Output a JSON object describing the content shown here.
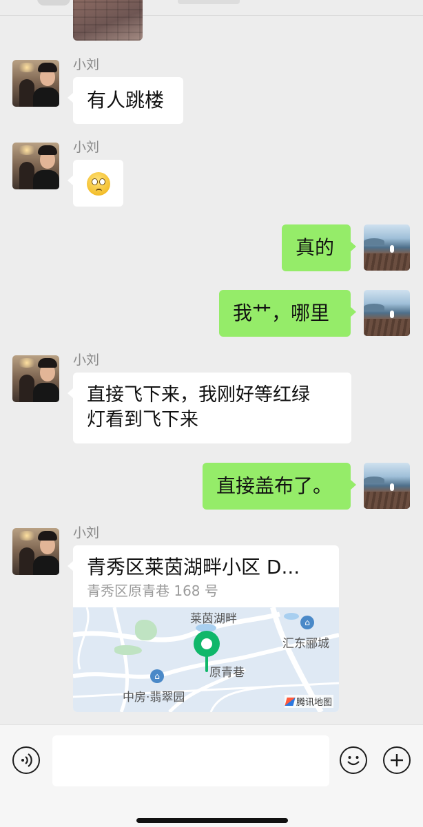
{
  "messages": [
    {
      "sender": "小刘",
      "text": "有人跳楼"
    },
    {
      "sender": "小刘",
      "emoji": "worried-face"
    },
    {
      "sender": "me",
      "text": "真的"
    },
    {
      "sender": "me",
      "text": "我艹，哪里"
    },
    {
      "sender": "小刘",
      "text_line1": "直接飞下来，我刚好等红绿",
      "text_line2": "灯看到飞下来"
    },
    {
      "sender": "me",
      "text": "直接盖布了。"
    },
    {
      "sender": "小刘",
      "location": {
        "title": "青秀区莱茵湖畔小区 D...",
        "address": "青秀区原青巷 168 号",
        "map_labels": {
          "top": "莱茵湖畔",
          "right": "汇东郦城",
          "street": "原青巷",
          "bottom_left": "中房·翡翠园",
          "brand": "腾讯地图"
        }
      }
    }
  ],
  "colors": {
    "background": "#ededed",
    "my_bubble": "#95ec69",
    "their_bubble": "#ffffff",
    "pin": "#10b76a"
  },
  "input_bar": {
    "voice_icon": "voice-icon",
    "emoji_icon": "smiley-icon",
    "plus_icon": "plus-icon",
    "text_value": ""
  }
}
